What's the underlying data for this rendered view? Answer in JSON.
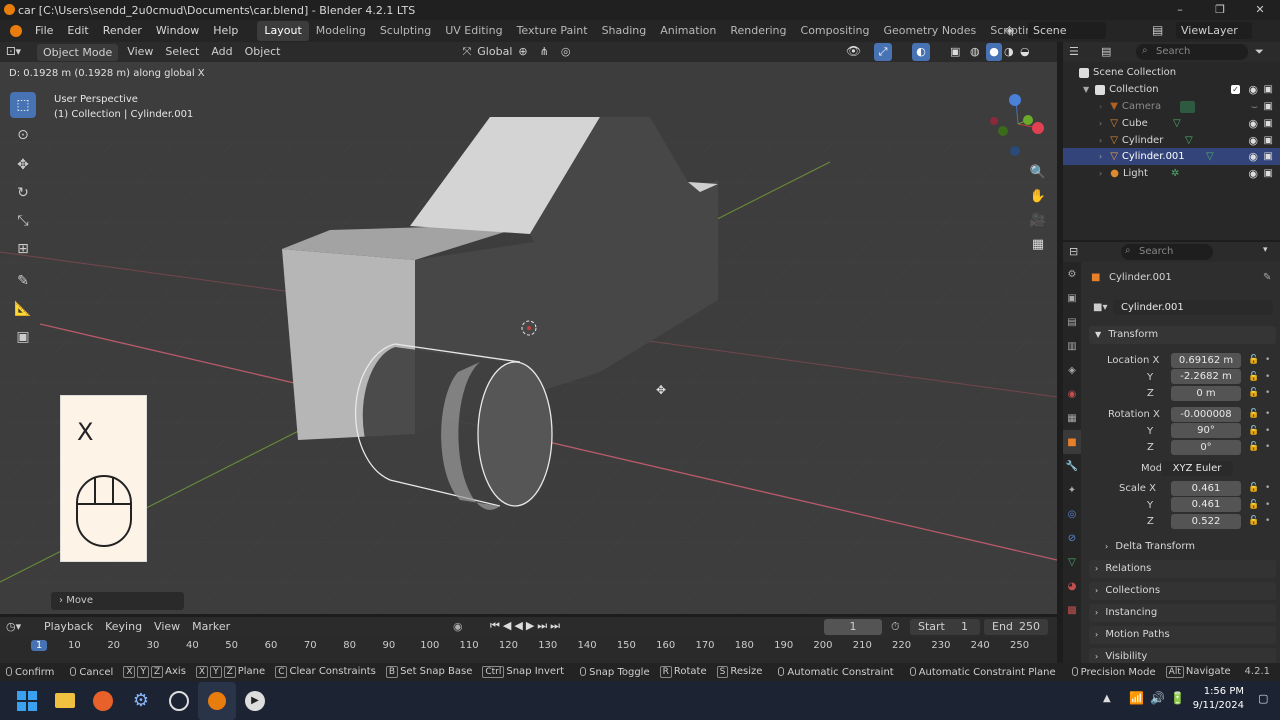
{
  "titlebar": {
    "title": "car [C:\\Users\\sendd_2u0cmud\\Documents\\car.blend] - Blender 4.2.1 LTS",
    "minimize": "–",
    "maximize": "❐",
    "close": "✕"
  },
  "menubar": {
    "menus": [
      "File",
      "Edit",
      "Render",
      "Window",
      "Help"
    ],
    "workspaces": [
      "Layout",
      "Modeling",
      "Sculpting",
      "UV Editing",
      "Texture Paint",
      "Shading",
      "Animation",
      "Rendering",
      "Compositing",
      "Geometry Nodes",
      "Scripting"
    ],
    "active_workspace": "Layout",
    "add_tab": "+",
    "scene": "Scene",
    "view_layer": "ViewLayer"
  },
  "viewport_header": {
    "mode": "Object Mode",
    "menus": [
      "View",
      "Select",
      "Add",
      "Object"
    ],
    "orientation": "Global"
  },
  "viewport": {
    "status": "D: 0.1928 m (0.1928 m) along global X",
    "perspective": "User Perspective",
    "collection_info": "(1) Collection | Cylinder.001"
  },
  "key_overlay": {
    "key": "X"
  },
  "last_op": {
    "label": "Move",
    "chevron": "›"
  },
  "outliner": {
    "search_placeholder": "Search",
    "scene_collection": "Scene Collection",
    "rows": [
      {
        "label": "Collection"
      },
      {
        "label": "Camera"
      },
      {
        "label": "Cube"
      },
      {
        "label": "Cylinder"
      },
      {
        "label": "Cylinder.001"
      },
      {
        "label": "Light"
      }
    ]
  },
  "properties": {
    "search_placeholder": "Search",
    "object_name": "Cylinder.001",
    "object_field": "Cylinder.001",
    "transform_label": "Transform",
    "location_label": "Location X",
    "location": [
      "0.69162 m",
      "-2.2682 m",
      "0 m"
    ],
    "rotation_label": "Rotation X",
    "rotation": [
      "-0.000008",
      "90°",
      "0°"
    ],
    "mode_label": "Mode",
    "mode_value": "XYZ Euler",
    "scale_label": "Scale X",
    "scale": [
      "0.461",
      "0.461",
      "0.522"
    ],
    "axis_y": "Y",
    "axis_z": "Z",
    "panels": [
      "Delta Transform",
      "Relations",
      "Collections",
      "Instancing",
      "Motion Paths",
      "Visibility"
    ]
  },
  "timeline": {
    "menus": [
      "Playback",
      "Keying",
      "View",
      "Marker"
    ],
    "current_frame": "1",
    "start_label": "Start",
    "start": "1",
    "end_label": "End",
    "end": "250",
    "ruler": [
      "1",
      "10",
      "20",
      "30",
      "40",
      "50",
      "60",
      "70",
      "80",
      "90",
      "100",
      "110",
      "120",
      "130",
      "140",
      "150",
      "160",
      "170",
      "180",
      "190",
      "200",
      "210",
      "220",
      "230",
      "240",
      "250"
    ]
  },
  "statusbar": {
    "items": [
      "Confirm",
      "Cancel",
      "Axis",
      "Plane",
      "Clear Constraints",
      "Set Snap Base",
      "Snap Invert",
      "Snap Toggle",
      "Rotate",
      "Resize",
      "Automatic Constraint",
      "Automatic Constraint Plane",
      "Precision Mode",
      "Navigate"
    ],
    "keys": [
      "",
      "",
      "X Y Z",
      "X Y Z",
      "C",
      "B",
      "Ctrl",
      "",
      "R",
      "S",
      "",
      "",
      "",
      "Alt"
    ],
    "version": "4.2.1"
  },
  "taskbar": {
    "time": "1:56 PM",
    "date": "9/11/2024"
  },
  "colors": {
    "accent": "#4772b3",
    "orange": "#e87d0d",
    "selected_row": "#33447a"
  }
}
